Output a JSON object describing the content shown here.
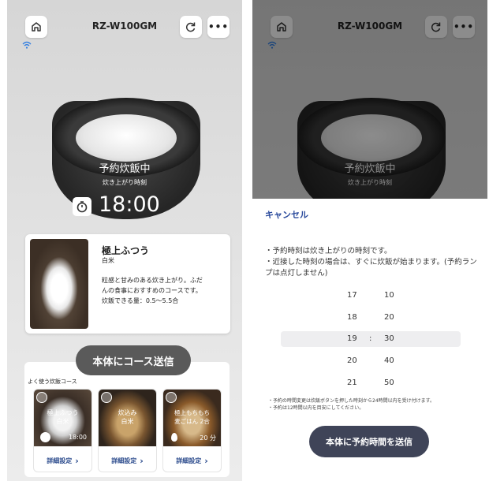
{
  "left": {
    "header": {
      "title": "RZ-W100GM"
    },
    "status": {
      "main": "予約炊飯中",
      "sub": "炊き上がり時刻",
      "time": "18:00"
    },
    "course": {
      "name": "極上ふつう",
      "type": "白米",
      "desc1": "粒感と甘みのある炊き上がり。ふだ",
      "desc2": "んの食事におすすめのコースです。",
      "capacity": "炊飯できる量：0.5～5.5合"
    },
    "send_button": "本体にコース送信",
    "favorites": {
      "title": "よく使う炊飯コース",
      "items": [
        {
          "line1": "極上ふつう",
          "line2": "白米",
          "meta": "18:00",
          "detail": "詳細設定"
        },
        {
          "line1": "炊込み",
          "line2": "白米",
          "meta": "",
          "detail": "詳細設定"
        },
        {
          "line1": "極上もちもち",
          "line2": "麦ごはん 2合",
          "meta": "20 分",
          "detail": "詳細設定"
        }
      ]
    }
  },
  "right": {
    "header": {
      "title": "RZ-W100GM"
    },
    "status": {
      "main": "予約炊飯中",
      "sub": "炊き上がり時刻"
    },
    "cancel": "キャンセル",
    "notes": [
      "・予約時刻は炊き上がりの時刻です。",
      "・近接した時刻の場合は、すぐに炊飯が始まります。(予約ランプは点灯しません)"
    ],
    "picker": {
      "hours": [
        "17",
        "18",
        "19",
        "20",
        "21"
      ],
      "minutes": [
        "10",
        "20",
        "30",
        "40",
        "50"
      ],
      "separator": ":"
    },
    "small_notes": [
      "・予約の時間変更は炊飯ボタンを押した時刻から24時間以内を受け付けます。",
      "・予約は12時間以内を目安にしてください。"
    ],
    "send_button": "本体に予約時間を送信"
  },
  "colors": {
    "accent": "#2a4a9c",
    "send_dark": "#3f4458",
    "pill_gray": "#5a5a5a"
  }
}
